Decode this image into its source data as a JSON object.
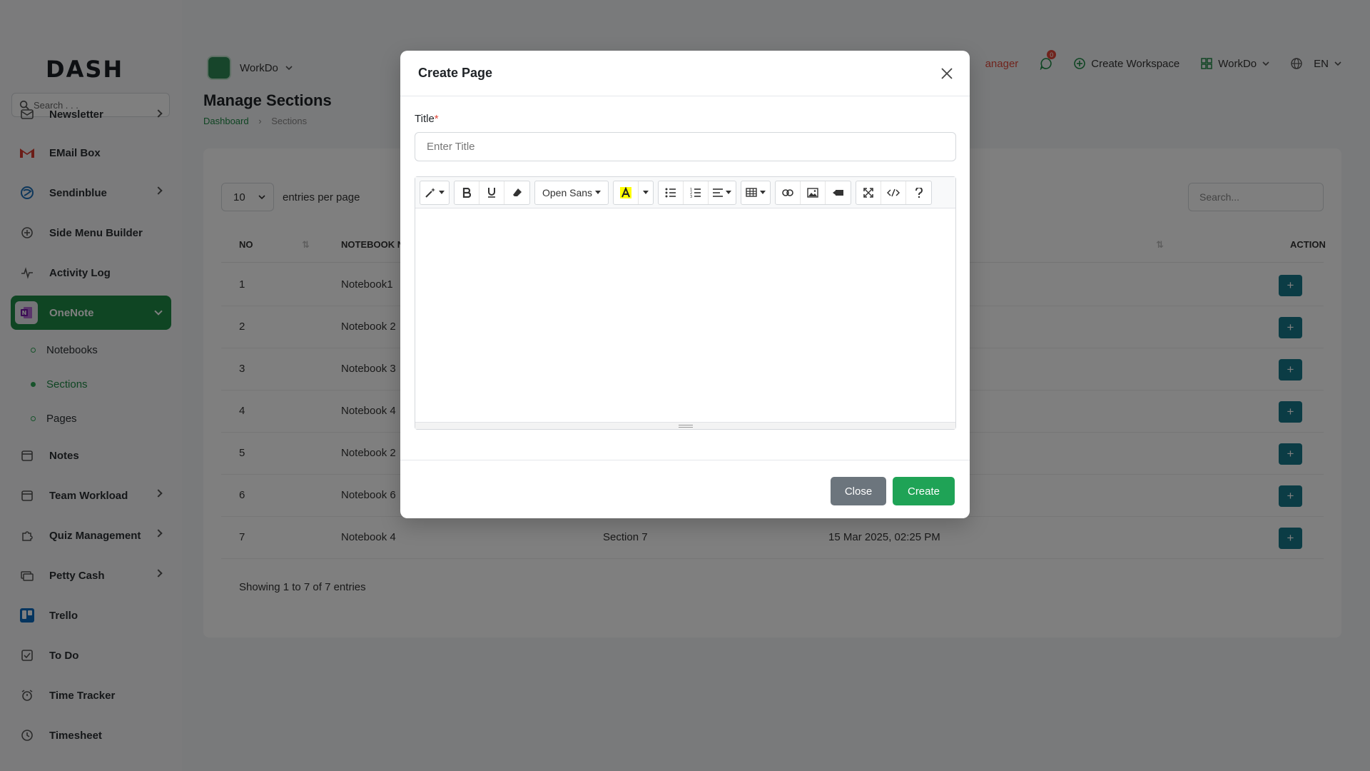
{
  "brand": {
    "logo_text": "DASH",
    "accent": "#1e8a46"
  },
  "sidebar": {
    "search_placeholder": "Search . . .",
    "items": [
      {
        "label": "Newsletter",
        "icon": "mail-icon",
        "has_children": true
      },
      {
        "label": "EMail Box",
        "icon": "gmail-icon",
        "has_children": false
      },
      {
        "label": "Sendinblue",
        "icon": "sendinblue-icon",
        "has_children": true
      },
      {
        "label": "Side Menu Builder",
        "icon": "plus-circle-icon",
        "has_children": false
      },
      {
        "label": "Activity Log",
        "icon": "pulse-icon",
        "has_children": false
      },
      {
        "label": "OneNote",
        "icon": "onenote-icon",
        "has_children": true,
        "active": true
      }
    ],
    "sub_items": [
      {
        "label": "Notebooks"
      },
      {
        "label": "Sections",
        "active": true
      },
      {
        "label": "Pages"
      }
    ],
    "items_after": [
      {
        "label": "Notes",
        "icon": "calendar-icon",
        "has_children": false
      },
      {
        "label": "Team Workload",
        "icon": "calendar-icon",
        "has_children": true
      },
      {
        "label": "Quiz Management",
        "icon": "puzzle-icon",
        "has_children": true
      },
      {
        "label": "Petty Cash",
        "icon": "cash-icon",
        "has_children": true
      },
      {
        "label": "Trello",
        "icon": "trello-icon",
        "has_children": false
      },
      {
        "label": "To Do",
        "icon": "checkbox-icon",
        "has_children": false
      },
      {
        "label": "Time Tracker",
        "icon": "alarm-icon",
        "has_children": false
      },
      {
        "label": "Timesheet",
        "icon": "clock-icon",
        "has_children": false
      }
    ]
  },
  "header": {
    "workspace": "WorkDo",
    "role_partial": "anager",
    "messages_badge": "0",
    "create_workspace": "Create Workspace",
    "workspace_menu": "WorkDo",
    "language": "EN"
  },
  "main": {
    "title": "Manage Sections",
    "breadcrumb": {
      "home": "Dashboard",
      "current": "Sections"
    },
    "per_page_value": "10",
    "per_page_label": "entries per page",
    "search_placeholder": "Search...",
    "columns": {
      "no": "NO",
      "notebook": "NOTEBOOK NA",
      "action": "ACTION"
    },
    "rows": [
      {
        "no": "1",
        "notebook": "Notebook1",
        "section": "",
        "date": ""
      },
      {
        "no": "2",
        "notebook": "Notebook 2",
        "section": "",
        "date": ""
      },
      {
        "no": "3",
        "notebook": "Notebook 3",
        "section": "",
        "date": ""
      },
      {
        "no": "4",
        "notebook": "Notebook 4",
        "section": "",
        "date": ""
      },
      {
        "no": "5",
        "notebook": "Notebook 2",
        "section": "",
        "date": ""
      },
      {
        "no": "6",
        "notebook": "Notebook 6",
        "section": "",
        "date": ""
      },
      {
        "no": "7",
        "notebook": "Notebook 4",
        "section": "Section 7",
        "date": "15 Mar 2025, 02:25 PM"
      }
    ],
    "action_symbol": "+",
    "showing": "Showing 1 to 7 of 7 entries"
  },
  "modal": {
    "title": "Create Page",
    "field_label": "Title",
    "required_mark": "*",
    "title_placeholder": "Enter Title",
    "font_name": "Open Sans",
    "close_label": "Close",
    "create_label": "Create"
  }
}
